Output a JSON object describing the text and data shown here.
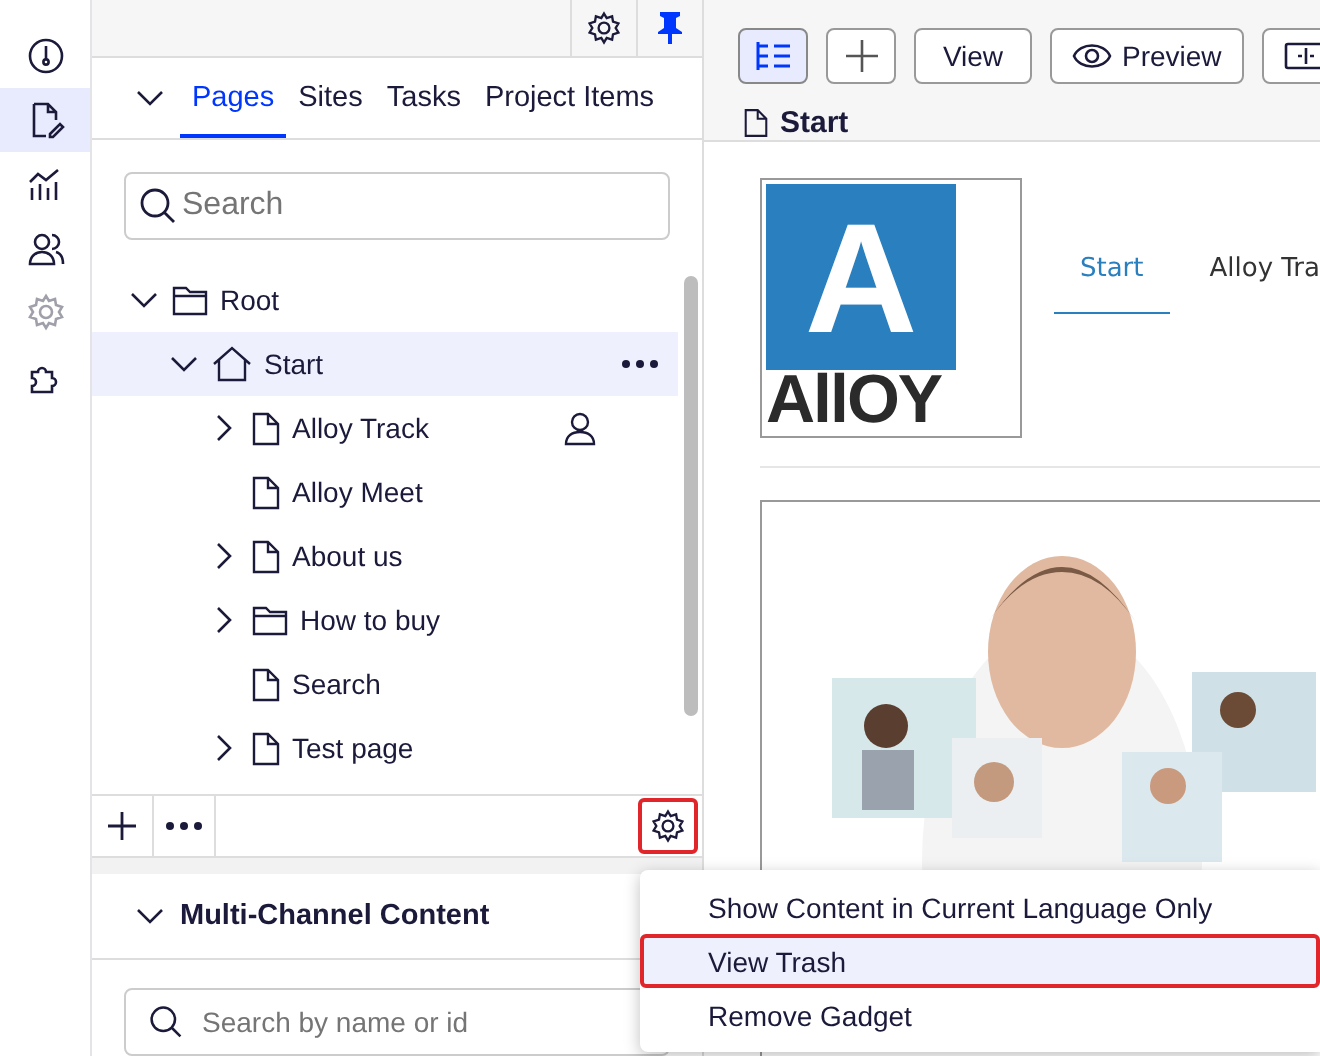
{
  "rail": [
    {
      "selected": false,
      "disabled": false
    },
    {
      "selected": true,
      "disabled": false
    },
    {
      "selected": false,
      "disabled": false
    },
    {
      "selected": false,
      "disabled": false
    },
    {
      "selected": false,
      "disabled": true
    },
    {
      "selected": false,
      "disabled": false
    }
  ],
  "navigation": {
    "tabs": [
      {
        "label": "Pages",
        "selected": true
      },
      {
        "label": "Sites",
        "selected": false
      },
      {
        "label": "Tasks",
        "selected": false
      },
      {
        "label": "Project Items",
        "selected": false
      }
    ],
    "search": {
      "placeholder": "Search"
    },
    "tree": [
      {
        "label": "Root",
        "kind": "folder",
        "expanded": true,
        "selected": false,
        "editing": false,
        "children": [
          {
            "label": "Start",
            "kind": "home",
            "expanded": true,
            "selected": true,
            "editing": false,
            "children": [
              {
                "label": "Alloy Track",
                "kind": "page",
                "expanded": false,
                "selected": false,
                "editing": true
              },
              {
                "label": "Alloy Meet",
                "kind": "page",
                "selected": false,
                "editing": false
              },
              {
                "label": "About us",
                "kind": "page",
                "expanded": false,
                "selected": false,
                "editing": false
              },
              {
                "label": "How to buy",
                "kind": "folder",
                "expanded": false,
                "selected": false,
                "editing": false
              },
              {
                "label": "Search",
                "kind": "page",
                "selected": false,
                "editing": false
              },
              {
                "label": "Test page",
                "kind": "page",
                "expanded": false,
                "selected": false,
                "editing": false
              }
            ]
          }
        ]
      }
    ]
  },
  "multi_channel": {
    "title": "Multi-Channel Content",
    "search": {
      "placeholder": "Search by name or id"
    }
  },
  "settings_menu": [
    {
      "label": "Show Content in Current Language Only",
      "selected": false
    },
    {
      "label": "View Trash",
      "selected": true
    },
    {
      "label": "Remove Gadget",
      "selected": false
    }
  ],
  "toolbar": {
    "buttons": [
      {
        "kind": "tree",
        "selected": true
      },
      {
        "kind": "add",
        "selected": false
      },
      {
        "kind": "text",
        "label": "View",
        "selected": false
      },
      {
        "kind": "preview",
        "label": "Preview",
        "selected": false
      },
      {
        "kind": "compare",
        "selected": false
      }
    ]
  },
  "page_title": "Start",
  "site": {
    "logo": {
      "mark": "A",
      "wordmark": "AllOY"
    },
    "nav": [
      {
        "label": "Start",
        "selected": true
      },
      {
        "label": "Alloy Tra",
        "selected": false
      }
    ]
  }
}
